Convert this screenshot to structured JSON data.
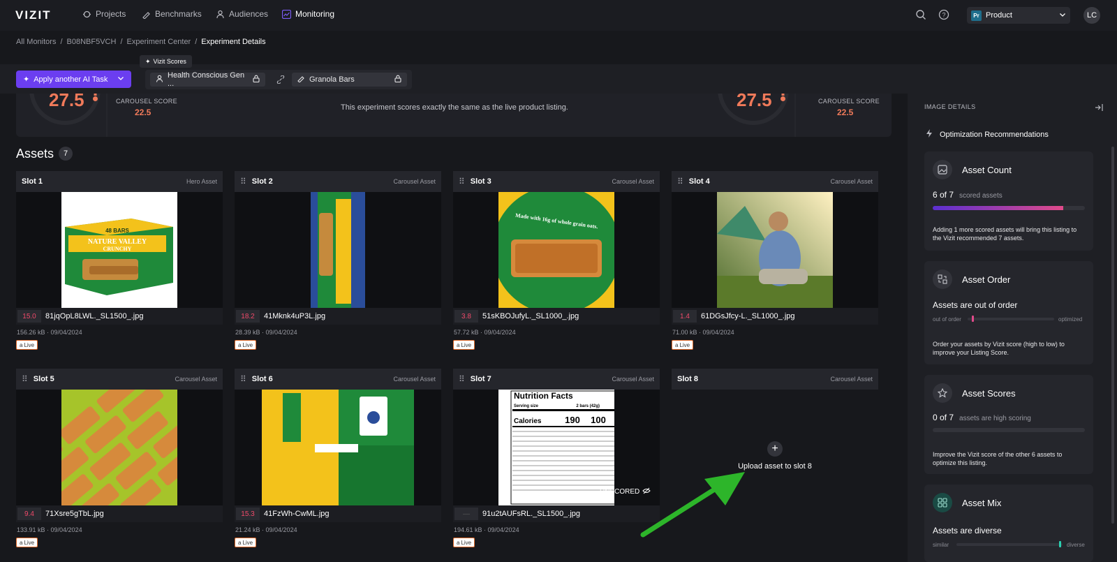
{
  "nav": {
    "logo": "VIZIT",
    "items": [
      {
        "label": "Projects",
        "icon": "projects-icon"
      },
      {
        "label": "Benchmarks",
        "icon": "benchmarks-icon"
      },
      {
        "label": "Audiences",
        "icon": "audiences-icon"
      },
      {
        "label": "Monitoring",
        "icon": "monitoring-icon",
        "active": true
      }
    ],
    "product_badge": "Pr",
    "product_label": "Product",
    "avatar_initials": "LC"
  },
  "breadcrumb": [
    "All Monitors",
    "B08NBF5VCH",
    "Experiment Center",
    "Experiment Details"
  ],
  "toolbar": {
    "ai_button": "Apply another AI Task",
    "vizit_scores_label": "Vizit Scores",
    "audience_chip": "Health Conscious Gen ...",
    "category_chip": "Granola Bars"
  },
  "score_strip": {
    "left_score": "27.5",
    "right_score": "27.5",
    "carousel_label": "CAROUSEL SCORE",
    "left_carousel": "22.5",
    "right_carousel": "22.5",
    "message": "This experiment scores exactly the same as the live product listing."
  },
  "assets": {
    "title": "Assets",
    "count": "7",
    "live_label": "Live",
    "upload_label": "Upload asset to slot 8",
    "unscored_label": "UNSCORED",
    "slots": [
      {
        "slot": "Slot 1",
        "kind": "Hero Asset",
        "score": "15.0",
        "file": "81jqOpL8LWL._SL1500_.jpg",
        "size": "156.26 kB",
        "date": "09/04/2024"
      },
      {
        "slot": "Slot 2",
        "kind": "Carousel Asset",
        "score": "18.2",
        "file": "41Mknk4uP3L.jpg",
        "size": "28.39 kB",
        "date": "09/04/2024"
      },
      {
        "slot": "Slot 3",
        "kind": "Carousel Asset",
        "score": "3.8",
        "file": "51sKBOJufyL._SL1000_.jpg",
        "size": "57.72 kB",
        "date": "09/04/2024"
      },
      {
        "slot": "Slot 4",
        "kind": "Carousel Asset",
        "score": "1.4",
        "file": "61DGsJfcy-L._SL1000_.jpg",
        "size": "71.00 kB",
        "date": "09/04/2024"
      },
      {
        "slot": "Slot 5",
        "kind": "Carousel Asset",
        "score": "9.4",
        "file": "71Xsre5gTbL.jpg",
        "size": "133.91 kB",
        "date": "09/04/2024"
      },
      {
        "slot": "Slot 6",
        "kind": "Carousel Asset",
        "score": "15.3",
        "file": "41FzWh-CwML.jpg",
        "size": "21.24 kB",
        "date": "09/04/2024"
      },
      {
        "slot": "Slot 7",
        "kind": "Carousel Asset",
        "score": "",
        "file": "91u2tAUFsRL._SL1500_.jpg",
        "size": "194.61 kB",
        "date": "09/04/2024"
      },
      {
        "slot": "Slot 8",
        "kind": "Carousel Asset"
      }
    ],
    "image_text": {
      "box_count": "48 BARS",
      "brand": "NATURE VALLEY",
      "crunchy": "CRUNCHY",
      "oats_claim": "Made with 16g of whole grain oats.",
      "nutrition_title": "Nutrition Facts",
      "serving_size": "Serving size",
      "serving_value": "2 bars (42g)",
      "calories": "Calories",
      "cal_1": "190",
      "cal_2": "100"
    }
  },
  "right_panel": {
    "title": "IMAGE DETAILS",
    "optimization": "Optimization Recommendations",
    "asset_count": {
      "name": "Asset Count",
      "value": "6 of 7",
      "sub": "scored assets",
      "progress": 0.86,
      "note": "Adding 1 more scored assets will bring this listing to the Vizit recommended 7 assets."
    },
    "asset_order": {
      "name": "Asset Order",
      "status": "Assets are out of order",
      "left": "out of order",
      "right": "optimized",
      "level": 0.05,
      "note": "Order your assets by Vizit score (high to low) to improve your Listing Score."
    },
    "asset_scores": {
      "name": "Asset Scores",
      "value": "0 of 7",
      "sub": "assets are high scoring",
      "progress": 0,
      "note": "Improve the Vizit score of the other 6 assets to optimize this listing."
    },
    "asset_mix": {
      "name": "Asset Mix",
      "status": "Assets are diverse",
      "left": "similar",
      "right": "diverse",
      "level": 0.97
    }
  },
  "colors": {
    "accent": "#6b3ef0",
    "score": "#f07a5a",
    "low_score": "#f04a6a",
    "arrow": "#2db52a"
  }
}
